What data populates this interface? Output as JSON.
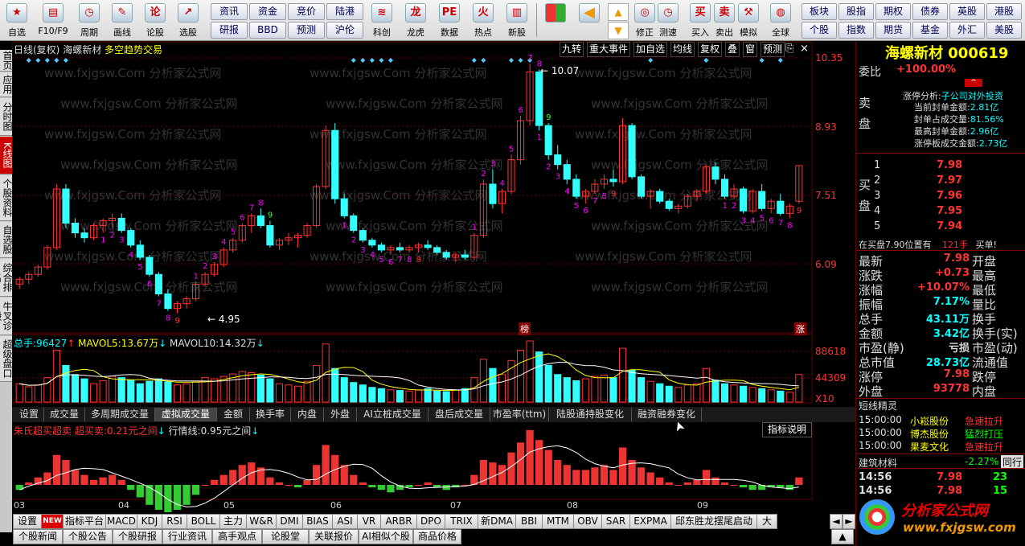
{
  "toolbar": {
    "big_buttons": [
      {
        "label": "自选",
        "icon": "star-icon"
      },
      {
        "label": "F10/F9",
        "icon": "f10-icon"
      },
      {
        "label": "周期",
        "icon": "clock-icon"
      },
      {
        "label": "画线",
        "icon": "pen-icon"
      },
      {
        "label": "论股",
        "icon": "discuss-icon"
      },
      {
        "label": "选股",
        "icon": "select-stock-icon"
      }
    ],
    "small_buttons_a": [
      "资讯",
      "资金",
      "竞价",
      "陆港",
      "研报",
      "BBD",
      "预测",
      "沪伦"
    ],
    "big_buttons_b": [
      {
        "label": "科创",
        "icon": "kechuang-icon"
      },
      {
        "label": "龙虎",
        "icon": "dragon-tiger-icon"
      },
      {
        "label": "数据",
        "icon": "data-icon"
      },
      {
        "label": "热点",
        "icon": "hotspot-icon"
      },
      {
        "label": "新股",
        "icon": "new-stock-icon"
      }
    ],
    "big_buttons_c": [
      {
        "label": "修正",
        "icon": "fix-icon"
      },
      {
        "label": "测速",
        "icon": "speed-icon"
      },
      {
        "label": "买入",
        "icon": "buy-icon"
      },
      {
        "label": "卖出",
        "icon": "sell-icon"
      },
      {
        "label": "模拟",
        "icon": "simulate-icon"
      },
      {
        "label": "全球",
        "icon": "globe-icon"
      }
    ],
    "small_buttons_b": [
      "板块",
      "股指",
      "期权",
      "债券",
      "英股",
      "港股",
      "个股",
      "指数",
      "期货",
      "基金",
      "外汇",
      "美股"
    ]
  },
  "left_tabs": [
    "首页",
    "应用",
    "分时图",
    "K线图",
    "个股资料",
    "自选股",
    "综合排名",
    "牛叉诊股",
    "超级盘口"
  ],
  "chart": {
    "header_left": "日线(复权)",
    "stock_name": "海螺新材",
    "indicator_name": "多空趋势交易",
    "toolbar_buttons": [
      "九转",
      "重大事件",
      "加自选",
      "均线",
      "复权",
      "叠",
      "窗",
      "预测"
    ],
    "price_axis": [
      "10.35",
      "8.93",
      "7.51",
      "6.09"
    ],
    "high_label": "10.07",
    "low_label": "4.95",
    "badge_bang": "榜",
    "badge_zhang": "涨",
    "watermark": "www.fxjgsw.Com 分析家公式网"
  },
  "volume_panel": {
    "label_total": "总手:",
    "total": "96427",
    "mavol5_label": "MAVOL5:",
    "mavol5": "13.67万",
    "mavol10_label": "MAVOL10:",
    "mavol10": "14.32万",
    "axis": [
      "88618",
      "44309",
      "X10"
    ]
  },
  "volume_tabs": [
    "设置",
    "成交量",
    "多周期成交量",
    "虚拟成交量",
    "金额",
    "换手率",
    "内盘",
    "外盘",
    "AI立桩成交量",
    "盘后成交量",
    "市盈率(ttm)",
    "陆股通持股变化",
    "融资融券变化"
  ],
  "indicator_panel": {
    "title": "朱氏超买超卖",
    "overbuy_label": "超买卖:",
    "overbuy": "0.21元之间",
    "trend_label": "行情线:",
    "trend": "0.95元之间",
    "help": "指标说明"
  },
  "x_axis": [
    "03",
    "04",
    "05",
    "06",
    "07",
    "08",
    "09"
  ],
  "bottom_tabs": [
    "设置",
    "NEW",
    "指标平台",
    "MACD",
    "KDJ",
    "RSI",
    "BOLL",
    "主力",
    "W&R",
    "DMI",
    "BIAS",
    "ASI",
    "VR",
    "ARBR",
    "DPO",
    "TRIX",
    "新DMA",
    "BBI",
    "MTM",
    "OBV",
    "SAR",
    "EXPMA",
    "邱东胜龙摆尾启动",
    "大"
  ],
  "bottom_tabs2": [
    "个股新闻",
    "个股公告",
    "个股研报",
    "行业资讯",
    "高手观点",
    "论股堂",
    "关联报价",
    "AI相似个股",
    "商品价格"
  ],
  "quote": {
    "name": "海螺新材",
    "code": "000619",
    "weibi_label": "委比",
    "weibi": "+100.00%",
    "sell_label": "卖盘",
    "buy_label": "买盘",
    "limit_analysis_label": "涨停分析:",
    "limit_analysis": "子公司对外投资",
    "limit_rows": [
      {
        "k": "当前封单金额:",
        "v": "2.81亿"
      },
      {
        "k": "封单占成交量:",
        "v": "81.56%"
      },
      {
        "k": "最高封单金额:",
        "v": "2.96亿"
      },
      {
        "k": "涨停板成交金额:",
        "v": "2.73亿"
      }
    ],
    "bids": [
      {
        "n": "1",
        "p": "7.98",
        "v": ""
      },
      {
        "n": "2",
        "p": "7.97",
        "v": ""
      },
      {
        "n": "3",
        "p": "7.96",
        "v": ""
      },
      {
        "n": "4",
        "p": "7.95",
        "v": ""
      },
      {
        "n": "5",
        "p": "7.94",
        "v": ""
      }
    ],
    "buyline_text": "在买盘7.90位置有",
    "buyline_vol": "121手",
    "buyline_tag": "买单!",
    "stats_left": [
      {
        "k": "最新",
        "v": "7.98",
        "c": "red"
      },
      {
        "k": "涨跌",
        "v": "+0.73",
        "c": "red"
      },
      {
        "k": "涨幅",
        "v": "+10.07%",
        "c": "red"
      },
      {
        "k": "振幅",
        "v": "7.17%",
        "c": "cyan"
      },
      {
        "k": "总手",
        "v": "43.11万",
        "c": "cyan"
      },
      {
        "k": "金额",
        "v": "3.42亿",
        "c": "cyan"
      },
      {
        "k": "市盈(静)",
        "v": "亏损",
        "c": "white"
      },
      {
        "k": "总市值",
        "v": "28.73亿",
        "c": "cyan"
      },
      {
        "k": "涨停",
        "v": "7.98",
        "c": "red"
      },
      {
        "k": "外盘",
        "v": "93778",
        "c": "red"
      }
    ],
    "stats_right": [
      "开盘",
      "最高",
      "最低",
      "量比",
      "换手",
      "换手(实)",
      "市盈(动)",
      "流通值",
      "跌停",
      "内盘"
    ],
    "short_label": "短线精灵",
    "short_rows": [
      {
        "t": "15:00:00",
        "n": "小崧股份",
        "e": "急速拉升"
      },
      {
        "t": "15:00:00",
        "n": "博杰股份",
        "e": "猛烈打压"
      },
      {
        "t": "15:00:00",
        "n": "果麦文化",
        "e": "急速拉升"
      }
    ],
    "sector": "建筑材料",
    "sector_chg": "-2.27%",
    "sector_tag": "同行",
    "ticks": [
      {
        "t": "14:56",
        "p": "7.98",
        "v": "23"
      },
      {
        "t": "14:56",
        "p": "7.98",
        "v": "15"
      }
    ],
    "logo_text": "分析家公式网",
    "logo_url": "www.fxjgsw.com"
  },
  "colors": {
    "up": "#ff3333",
    "down": "#33ffff",
    "bg": "#000000",
    "grid": "#660000"
  },
  "chart_data": {
    "type": "candlestick",
    "candles": [
      [
        5.55,
        5.7,
        5.45,
        5.65
      ],
      [
        5.65,
        5.8,
        5.55,
        5.75
      ],
      [
        5.75,
        5.95,
        5.7,
        5.9
      ],
      [
        5.9,
        6.35,
        5.85,
        6.3
      ],
      [
        6.3,
        7.6,
        6.25,
        7.5
      ],
      [
        7.5,
        7.6,
        6.7,
        6.8
      ],
      [
        6.8,
        6.9,
        6.5,
        6.6
      ],
      [
        6.6,
        6.7,
        6.4,
        6.5
      ],
      [
        6.5,
        6.8,
        6.45,
        6.75
      ],
      [
        6.75,
        6.9,
        6.6,
        6.85
      ],
      [
        6.85,
        7.0,
        6.7,
        6.9
      ],
      [
        6.9,
        7.0,
        6.6,
        6.65
      ],
      [
        6.65,
        6.7,
        6.3,
        6.35
      ],
      [
        6.35,
        6.45,
        6.05,
        6.1
      ],
      [
        6.1,
        6.15,
        5.7,
        5.75
      ],
      [
        5.75,
        5.8,
        5.3,
        5.35
      ],
      [
        5.35,
        5.45,
        5.0,
        5.05
      ],
      [
        5.05,
        5.2,
        4.95,
        5.15
      ],
      [
        5.15,
        5.3,
        5.05,
        5.25
      ],
      [
        5.25,
        5.6,
        5.2,
        5.55
      ],
      [
        5.55,
        5.8,
        5.5,
        5.75
      ],
      [
        5.75,
        6.0,
        5.7,
        5.95
      ],
      [
        5.95,
        6.3,
        5.9,
        6.25
      ],
      [
        6.25,
        6.5,
        6.2,
        6.45
      ],
      [
        6.45,
        6.8,
        6.4,
        6.75
      ],
      [
        6.75,
        7.0,
        6.6,
        6.95
      ],
      [
        6.95,
        7.1,
        6.7,
        6.75
      ],
      [
        6.75,
        6.85,
        6.3,
        6.35
      ],
      [
        6.35,
        6.5,
        6.25,
        6.45
      ],
      [
        6.45,
        6.6,
        6.35,
        6.5
      ],
      [
        6.5,
        6.6,
        6.3,
        6.55
      ],
      [
        6.55,
        6.8,
        6.5,
        6.75
      ],
      [
        6.75,
        7.6,
        6.7,
        7.55
      ],
      [
        7.55,
        8.8,
        7.5,
        8.7
      ],
      [
        8.7,
        8.85,
        7.2,
        7.3
      ],
      [
        7.3,
        7.4,
        6.9,
        6.95
      ],
      [
        6.95,
        7.0,
        6.6,
        6.65
      ],
      [
        6.65,
        6.7,
        6.4,
        6.45
      ],
      [
        6.45,
        6.5,
        6.3,
        6.35
      ],
      [
        6.35,
        6.4,
        6.2,
        6.25
      ],
      [
        6.25,
        6.35,
        6.15,
        6.3
      ],
      [
        6.3,
        6.4,
        6.2,
        6.25
      ],
      [
        6.25,
        6.35,
        6.2,
        6.3
      ],
      [
        6.3,
        6.4,
        6.2,
        6.35
      ],
      [
        6.35,
        6.45,
        6.25,
        6.3
      ],
      [
        6.3,
        6.35,
        6.15,
        6.2
      ],
      [
        6.2,
        6.25,
        6.05,
        6.1
      ],
      [
        6.1,
        6.2,
        6.0,
        6.15
      ],
      [
        6.15,
        6.25,
        6.05,
        6.1
      ],
      [
        6.1,
        6.6,
        6.05,
        6.55
      ],
      [
        6.55,
        7.7,
        6.5,
        7.6
      ],
      [
        7.6,
        7.9,
        7.1,
        7.2
      ],
      [
        7.2,
        7.5,
        7.0,
        7.45
      ],
      [
        7.45,
        8.2,
        7.4,
        8.1
      ],
      [
        8.1,
        9.0,
        8.0,
        8.9
      ],
      [
        8.9,
        10.07,
        8.8,
        9.9
      ],
      [
        9.9,
        9.95,
        8.7,
        8.8
      ],
      [
        8.8,
        8.85,
        8.1,
        8.2
      ],
      [
        8.2,
        8.4,
        7.9,
        8.0
      ],
      [
        8.0,
        8.1,
        7.6,
        7.7
      ],
      [
        7.7,
        7.8,
        7.3,
        7.35
      ],
      [
        7.35,
        7.5,
        7.2,
        7.45
      ],
      [
        7.45,
        7.7,
        7.4,
        7.6
      ],
      [
        7.6,
        7.8,
        7.5,
        7.7
      ],
      [
        7.7,
        7.9,
        7.55,
        7.65
      ],
      [
        7.65,
        8.95,
        7.6,
        8.8
      ],
      [
        8.8,
        8.85,
        7.7,
        7.75
      ],
      [
        7.75,
        7.8,
        7.3,
        7.35
      ],
      [
        7.35,
        7.5,
        7.1,
        7.45
      ],
      [
        7.45,
        7.5,
        7.2,
        7.25
      ],
      [
        7.25,
        7.3,
        7.05,
        7.1
      ],
      [
        7.1,
        7.2,
        7.0,
        7.15
      ],
      [
        7.15,
        7.4,
        7.1,
        7.35
      ],
      [
        7.35,
        7.5,
        7.25,
        7.45
      ],
      [
        7.45,
        8.0,
        7.4,
        7.95
      ],
      [
        7.95,
        8.05,
        7.6,
        7.7
      ],
      [
        7.7,
        7.8,
        7.3,
        7.35
      ],
      [
        7.35,
        7.6,
        7.3,
        7.5
      ],
      [
        7.5,
        7.55,
        7.0,
        7.05
      ],
      [
        7.05,
        7.5,
        7.0,
        7.45
      ],
      [
        7.45,
        7.6,
        7.05,
        7.1
      ],
      [
        7.1,
        7.3,
        7.0,
        7.25
      ],
      [
        7.25,
        7.4,
        6.95,
        7.0
      ],
      [
        7.0,
        7.2,
        6.9,
        7.15
      ],
      [
        7.25,
        7.98,
        7.2,
        7.98
      ]
    ],
    "volume": [
      30,
      25,
      28,
      40,
      85,
      60,
      45,
      38,
      30,
      35,
      42,
      40,
      36,
      30,
      34,
      38,
      33,
      28,
      30,
      34,
      40,
      38,
      42,
      46,
      50,
      48,
      44,
      38,
      30,
      28,
      26,
      34,
      60,
      95,
      55,
      40,
      32,
      28,
      24,
      22,
      20,
      19,
      18,
      20,
      22,
      18,
      17,
      20,
      22,
      40,
      70,
      55,
      45,
      68,
      85,
      100,
      82,
      60,
      45,
      40,
      35,
      38,
      42,
      44,
      40,
      88,
      52,
      40,
      34,
      30,
      26,
      24,
      28,
      30,
      55,
      36,
      30,
      28,
      26,
      24,
      22,
      20,
      18,
      16,
      45
    ],
    "oscillator": [
      -2,
      1,
      3,
      5,
      12,
      10,
      6,
      4,
      2,
      3,
      4,
      2,
      -2,
      -5,
      -8,
      -10,
      -12,
      -10,
      -8,
      -4,
      0,
      2,
      4,
      6,
      8,
      9,
      7,
      3,
      1,
      0,
      -1,
      2,
      8,
      16,
      12,
      8,
      4,
      1,
      -1,
      -2,
      -3,
      -2,
      -1,
      0,
      1,
      -1,
      -2,
      -1,
      0,
      4,
      10,
      9,
      8,
      13,
      17,
      22,
      18,
      14,
      10,
      8,
      6,
      6,
      7,
      8,
      6,
      15,
      10,
      7,
      5,
      3,
      1,
      0,
      1,
      2,
      6,
      3,
      1,
      0,
      -1,
      -2,
      -2,
      -1,
      -1,
      -2,
      3
    ]
  }
}
